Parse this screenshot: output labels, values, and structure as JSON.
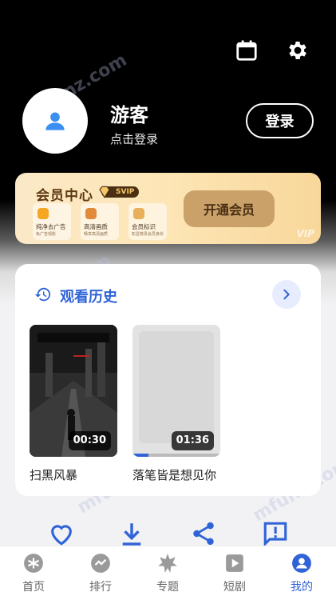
{
  "header": {
    "calendar_icon": "calendar-icon",
    "settings_icon": "gear-icon"
  },
  "profile": {
    "username": "游客",
    "subtitle": "点击登录",
    "login_label": "登录"
  },
  "vip": {
    "title": "会员中心",
    "badge": "SVIP",
    "perks": [
      {
        "label": "纯净去广告",
        "sub": "免广告观影",
        "color": "#f5a623"
      },
      {
        "label": "高清画质",
        "sub": "畅享高清画质",
        "color": "#e08a3a"
      },
      {
        "label": "会员标识",
        "sub": "彰显尊贵会员身份",
        "color": "#e8b05a"
      }
    ],
    "open_label": "开通会员",
    "watermark": "VIP"
  },
  "history": {
    "title": "观看历史",
    "videos": [
      {
        "title": "扫黑风暴",
        "duration": "00:30",
        "progress": 0.0
      },
      {
        "title": "落笔皆是想见你",
        "duration": "01:36",
        "progress": 0.18
      }
    ]
  },
  "actions": [
    "heart-icon",
    "download-icon",
    "share-icon",
    "feedback-icon"
  ],
  "nav": [
    {
      "label": "首页",
      "icon": "home-icon"
    },
    {
      "label": "排行",
      "icon": "ranking-icon"
    },
    {
      "label": "专题",
      "icon": "topic-icon"
    },
    {
      "label": "短剧",
      "icon": "short-drama-icon"
    },
    {
      "label": "我的",
      "icon": "profile-icon",
      "active": true
    }
  ],
  "colors": {
    "accent": "#2f63d7",
    "vip_gold": "#c9a169"
  },
  "watermarks": [
    "mfunz.com",
    "mfunz.com",
    "mfunz.com",
    "mfunz.com"
  ]
}
